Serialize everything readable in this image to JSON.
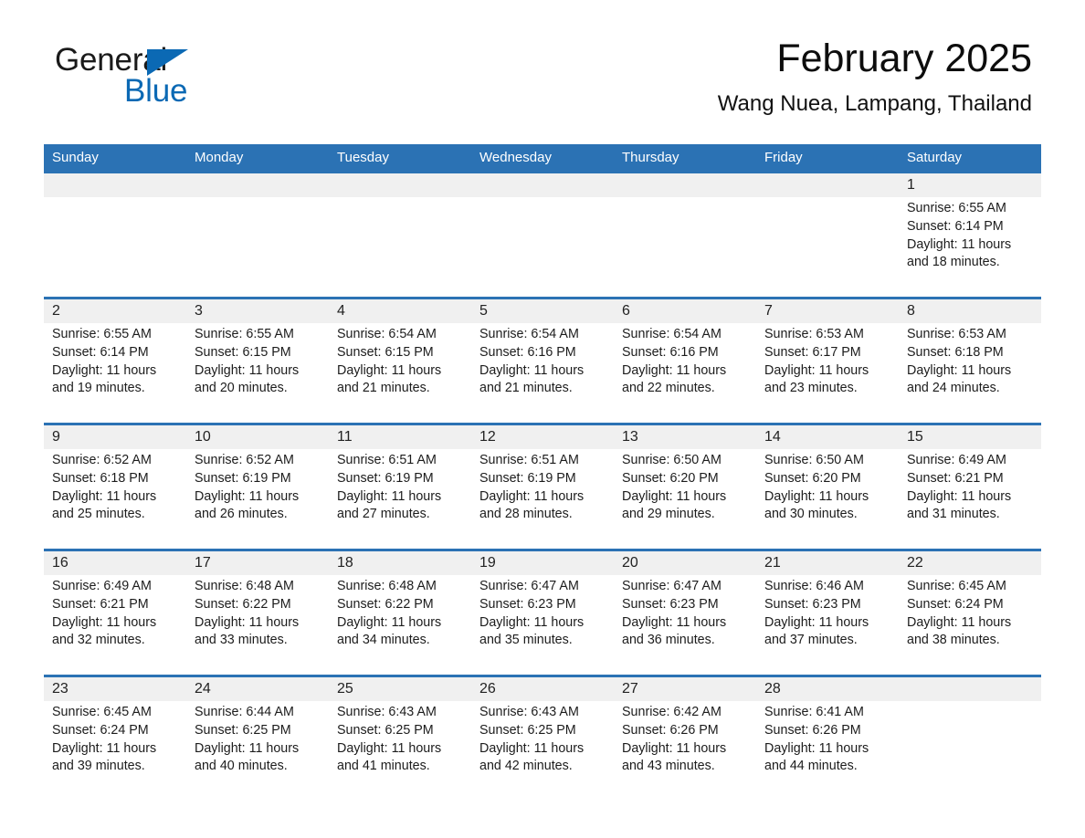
{
  "brand": {
    "name_part1": "General",
    "name_part2": "Blue",
    "accent_color": "#0b69b4"
  },
  "header": {
    "title": "February 2025",
    "subtitle": "Wang Nuea, Lampang, Thailand",
    "header_bg_color": "#2b72b4",
    "date_strip_color": "#f0f0f0"
  },
  "weekday_headers": [
    "Sunday",
    "Monday",
    "Tuesday",
    "Wednesday",
    "Thursday",
    "Friday",
    "Saturday"
  ],
  "labels": {
    "sunrise_prefix": "Sunrise:",
    "sunset_prefix": "Sunset:",
    "daylight_prefix": "Daylight:"
  },
  "weeks": [
    [
      {
        "day": "",
        "sunrise": "",
        "sunset": "",
        "daylight": "",
        "empty": true
      },
      {
        "day": "",
        "sunrise": "",
        "sunset": "",
        "daylight": "",
        "empty": true
      },
      {
        "day": "",
        "sunrise": "",
        "sunset": "",
        "daylight": "",
        "empty": true
      },
      {
        "day": "",
        "sunrise": "",
        "sunset": "",
        "daylight": "",
        "empty": true
      },
      {
        "day": "",
        "sunrise": "",
        "sunset": "",
        "daylight": "",
        "empty": true
      },
      {
        "day": "",
        "sunrise": "",
        "sunset": "",
        "daylight": "",
        "empty": true
      },
      {
        "day": "1",
        "sunrise": "Sunrise: 6:55 AM",
        "sunset": "Sunset: 6:14 PM",
        "daylight": "Daylight: 11 hours and 18 minutes.",
        "empty": false
      }
    ],
    [
      {
        "day": "2",
        "sunrise": "Sunrise: 6:55 AM",
        "sunset": "Sunset: 6:14 PM",
        "daylight": "Daylight: 11 hours and 19 minutes.",
        "empty": false
      },
      {
        "day": "3",
        "sunrise": "Sunrise: 6:55 AM",
        "sunset": "Sunset: 6:15 PM",
        "daylight": "Daylight: 11 hours and 20 minutes.",
        "empty": false
      },
      {
        "day": "4",
        "sunrise": "Sunrise: 6:54 AM",
        "sunset": "Sunset: 6:15 PM",
        "daylight": "Daylight: 11 hours and 21 minutes.",
        "empty": false
      },
      {
        "day": "5",
        "sunrise": "Sunrise: 6:54 AM",
        "sunset": "Sunset: 6:16 PM",
        "daylight": "Daylight: 11 hours and 21 minutes.",
        "empty": false
      },
      {
        "day": "6",
        "sunrise": "Sunrise: 6:54 AM",
        "sunset": "Sunset: 6:16 PM",
        "daylight": "Daylight: 11 hours and 22 minutes.",
        "empty": false
      },
      {
        "day": "7",
        "sunrise": "Sunrise: 6:53 AM",
        "sunset": "Sunset: 6:17 PM",
        "daylight": "Daylight: 11 hours and 23 minutes.",
        "empty": false
      },
      {
        "day": "8",
        "sunrise": "Sunrise: 6:53 AM",
        "sunset": "Sunset: 6:18 PM",
        "daylight": "Daylight: 11 hours and 24 minutes.",
        "empty": false
      }
    ],
    [
      {
        "day": "9",
        "sunrise": "Sunrise: 6:52 AM",
        "sunset": "Sunset: 6:18 PM",
        "daylight": "Daylight: 11 hours and 25 minutes.",
        "empty": false
      },
      {
        "day": "10",
        "sunrise": "Sunrise: 6:52 AM",
        "sunset": "Sunset: 6:19 PM",
        "daylight": "Daylight: 11 hours and 26 minutes.",
        "empty": false
      },
      {
        "day": "11",
        "sunrise": "Sunrise: 6:51 AM",
        "sunset": "Sunset: 6:19 PM",
        "daylight": "Daylight: 11 hours and 27 minutes.",
        "empty": false
      },
      {
        "day": "12",
        "sunrise": "Sunrise: 6:51 AM",
        "sunset": "Sunset: 6:19 PM",
        "daylight": "Daylight: 11 hours and 28 minutes.",
        "empty": false
      },
      {
        "day": "13",
        "sunrise": "Sunrise: 6:50 AM",
        "sunset": "Sunset: 6:20 PM",
        "daylight": "Daylight: 11 hours and 29 minutes.",
        "empty": false
      },
      {
        "day": "14",
        "sunrise": "Sunrise: 6:50 AM",
        "sunset": "Sunset: 6:20 PM",
        "daylight": "Daylight: 11 hours and 30 minutes.",
        "empty": false
      },
      {
        "day": "15",
        "sunrise": "Sunrise: 6:49 AM",
        "sunset": "Sunset: 6:21 PM",
        "daylight": "Daylight: 11 hours and 31 minutes.",
        "empty": false
      }
    ],
    [
      {
        "day": "16",
        "sunrise": "Sunrise: 6:49 AM",
        "sunset": "Sunset: 6:21 PM",
        "daylight": "Daylight: 11 hours and 32 minutes.",
        "empty": false
      },
      {
        "day": "17",
        "sunrise": "Sunrise: 6:48 AM",
        "sunset": "Sunset: 6:22 PM",
        "daylight": "Daylight: 11 hours and 33 minutes.",
        "empty": false
      },
      {
        "day": "18",
        "sunrise": "Sunrise: 6:48 AM",
        "sunset": "Sunset: 6:22 PM",
        "daylight": "Daylight: 11 hours and 34 minutes.",
        "empty": false
      },
      {
        "day": "19",
        "sunrise": "Sunrise: 6:47 AM",
        "sunset": "Sunset: 6:23 PM",
        "daylight": "Daylight: 11 hours and 35 minutes.",
        "empty": false
      },
      {
        "day": "20",
        "sunrise": "Sunrise: 6:47 AM",
        "sunset": "Sunset: 6:23 PM",
        "daylight": "Daylight: 11 hours and 36 minutes.",
        "empty": false
      },
      {
        "day": "21",
        "sunrise": "Sunrise: 6:46 AM",
        "sunset": "Sunset: 6:23 PM",
        "daylight": "Daylight: 11 hours and 37 minutes.",
        "empty": false
      },
      {
        "day": "22",
        "sunrise": "Sunrise: 6:45 AM",
        "sunset": "Sunset: 6:24 PM",
        "daylight": "Daylight: 11 hours and 38 minutes.",
        "empty": false
      }
    ],
    [
      {
        "day": "23",
        "sunrise": "Sunrise: 6:45 AM",
        "sunset": "Sunset: 6:24 PM",
        "daylight": "Daylight: 11 hours and 39 minutes.",
        "empty": false
      },
      {
        "day": "24",
        "sunrise": "Sunrise: 6:44 AM",
        "sunset": "Sunset: 6:25 PM",
        "daylight": "Daylight: 11 hours and 40 minutes.",
        "empty": false
      },
      {
        "day": "25",
        "sunrise": "Sunrise: 6:43 AM",
        "sunset": "Sunset: 6:25 PM",
        "daylight": "Daylight: 11 hours and 41 minutes.",
        "empty": false
      },
      {
        "day": "26",
        "sunrise": "Sunrise: 6:43 AM",
        "sunset": "Sunset: 6:25 PM",
        "daylight": "Daylight: 11 hours and 42 minutes.",
        "empty": false
      },
      {
        "day": "27",
        "sunrise": "Sunrise: 6:42 AM",
        "sunset": "Sunset: 6:26 PM",
        "daylight": "Daylight: 11 hours and 43 minutes.",
        "empty": false
      },
      {
        "day": "28",
        "sunrise": "Sunrise: 6:41 AM",
        "sunset": "Sunset: 6:26 PM",
        "daylight": "Daylight: 11 hours and 44 minutes.",
        "empty": false
      },
      {
        "day": "",
        "sunrise": "",
        "sunset": "",
        "daylight": "",
        "empty": true
      }
    ]
  ]
}
